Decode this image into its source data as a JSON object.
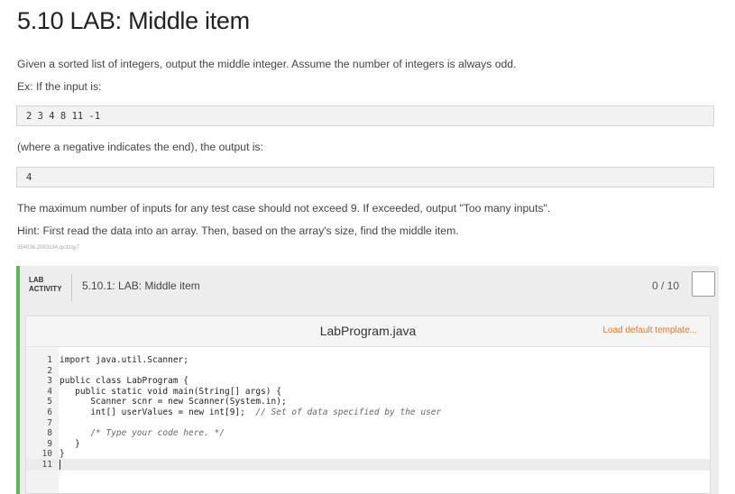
{
  "page": {
    "title": "5.10 LAB: Middle item",
    "intro": "Given a sorted list of integers, output the middle integer. Assume the number of integers is always odd.",
    "example_label": "Ex: If the input is:",
    "example_input": "2 3 4 8 11 -1",
    "output_label": "(where a negative indicates the end), the output is:",
    "example_output": "4",
    "max_note": "The maximum number of inputs for any test case should not exceed 9. If exceeded, output \"Too many inputs\".",
    "hint": "Hint: First read the data into an array. Then, based on the array's size, find the middle item.",
    "tracking_id": "354036.2093194.qx3zqy7"
  },
  "lab": {
    "label_line1": "LAB",
    "label_line2": "ACTIVITY",
    "name": "5.10.1: LAB: Middle item",
    "score": "0 / 10"
  },
  "editor": {
    "filename": "LabProgram.java",
    "load_template": "Load default template...",
    "lines": [
      {
        "n": "1",
        "code": "import java.util.Scanner;",
        "comment": ""
      },
      {
        "n": "2",
        "code": "",
        "comment": ""
      },
      {
        "n": "3",
        "code": "public class LabProgram {",
        "comment": ""
      },
      {
        "n": "4",
        "code": "   public static void main(String[] args) {",
        "comment": ""
      },
      {
        "n": "5",
        "code": "      Scanner scnr = new Scanner(System.in);",
        "comment": ""
      },
      {
        "n": "6",
        "code": "      int[] userValues = new int[9];  ",
        "comment": "// Set of data specified by the user"
      },
      {
        "n": "7",
        "code": "",
        "comment": ""
      },
      {
        "n": "8",
        "code": "      ",
        "comment": "/* Type your code here. */"
      },
      {
        "n": "9",
        "code": "   }",
        "comment": ""
      },
      {
        "n": "10",
        "code": "}",
        "comment": ""
      },
      {
        "n": "11",
        "code": "",
        "comment": ""
      }
    ]
  }
}
